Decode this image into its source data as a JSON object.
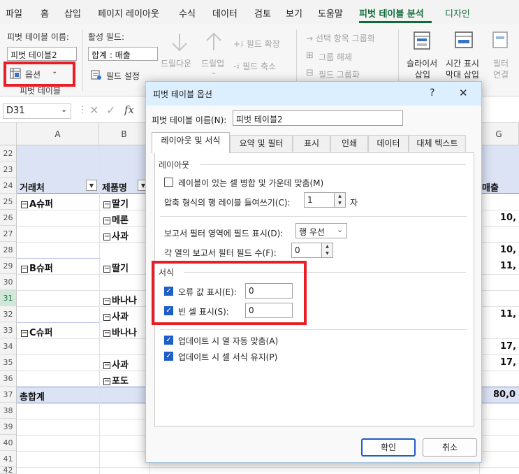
{
  "menu": {
    "tabs": [
      "파일",
      "홈",
      "삽입",
      "페이지 레이아웃",
      "수식",
      "데이터",
      "검토",
      "보기",
      "도움말",
      "피벗 테이블 분석",
      "디자인"
    ],
    "active_index": 9,
    "accent": "#0f6b37"
  },
  "ribbon": {
    "pivot_name_label": "피벗 테이블 이름:",
    "pivot_name_value": "피벗 테이블2",
    "options_label": "옵션",
    "group_pivot_table": "피벗 테이블",
    "active_field_label": "활성 필드:",
    "active_field_value": "합계 : 매출",
    "field_settings": "필드 설정",
    "drill_down": "드릴다운",
    "drill_up": "드릴업",
    "expand_field": "+፤ 필드 확장",
    "collapse_field": "-፤ 필드 축소",
    "group_selection": "→ 선택 항목 그룹화",
    "ungroup": "그룹 해제",
    "group_field": "필드 그룹화",
    "insert_slicer_1": "슬라이서",
    "insert_slicer_2": "삽입",
    "insert_timeline_1": "시간 표시",
    "insert_timeline_2": "막대 삽입",
    "filter_conn_1": "필터",
    "filter_conn_2": "연결",
    "highlight_color": "#ea1c24"
  },
  "formula_bar": {
    "name_box": "D31",
    "fx": "fx"
  },
  "grid": {
    "columns": [
      "A",
      "B",
      "G"
    ],
    "rows": [
      "22",
      "23",
      "24",
      "25",
      "26",
      "27",
      "28",
      "29",
      "30",
      "31",
      "32",
      "33",
      "34",
      "35",
      "36",
      "37",
      "38",
      "39",
      "40",
      "41",
      "42"
    ],
    "selected_row": "31",
    "header_a": "거래처",
    "header_b": "제품명",
    "header_g": "매출",
    "a_values": [
      "A슈퍼",
      "B슈퍼",
      "C슈퍼"
    ],
    "b_values": [
      "딸기",
      "메론",
      "사과",
      "딸기",
      "바나나",
      "사과",
      "바나나",
      "사과",
      "포도"
    ],
    "g_values": [
      "10,",
      "10,",
      "11,",
      "11,",
      "17,",
      "17,",
      "80,0"
    ],
    "grand_total": "총합계",
    "header_fill": "#dce3f5"
  },
  "dialog": {
    "title": "피벗 테이블 옵션",
    "help": "?",
    "close": "✕",
    "name_label": "피벗 테이블 이름(N):",
    "name_value": "피벗 테이블2",
    "tabs": [
      "레이아웃 및 서식",
      "요약 및 필터",
      "표시",
      "인쇄",
      "데이터",
      "대체 텍스트"
    ],
    "active_tab": 0,
    "layout_section": "레이아웃",
    "merge_label": "레이블이 있는 셀 병합 및 가운데 맞춤(M)",
    "indent_label": "압축 형식의 행 레이블 들여쓰기(C):",
    "indent_value": "1",
    "indent_unit": "자",
    "report_filter_label": "보고서 필터 영역에 필드 표시(D):",
    "report_filter_value": "행 우선",
    "filter_fields_label": "각 열의 보고서 필터 필드 수(F):",
    "filter_fields_value": "0",
    "format_section": "서식",
    "error_label": "오류 값 표시(E):",
    "error_value": "0",
    "empty_label": "빈 셀 표시(S):",
    "empty_value": "0",
    "autofit_label": "업데이트 시 열 자동 맞춤(A)",
    "preserve_label": "업데이트 시 셀 서식 유지(P)",
    "ok": "확인",
    "cancel": "취소",
    "checkbox_color": "#1e5ec9"
  }
}
